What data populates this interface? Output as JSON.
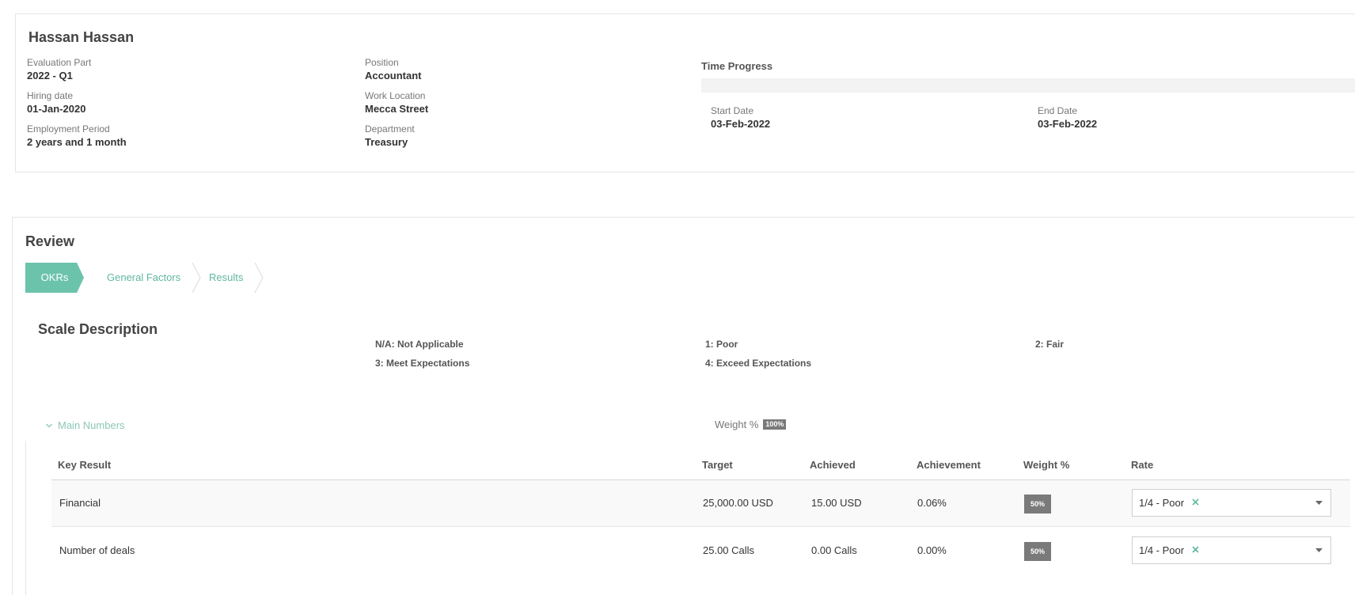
{
  "employee": {
    "name": "Hassan Hassan",
    "fields": {
      "evaluation_part": {
        "label": "Evaluation Part",
        "value": "2022 - Q1"
      },
      "hiring_date": {
        "label": "Hiring date",
        "value": "01-Jan-2020"
      },
      "employment_period": {
        "label": "Employment Period",
        "value": "2 years and 1 month"
      },
      "position": {
        "label": "Position",
        "value": "Accountant"
      },
      "work_location": {
        "label": "Work Location",
        "value": "Mecca Street"
      },
      "department": {
        "label": "Department",
        "value": "Treasury"
      }
    },
    "time_progress": {
      "title": "Time Progress",
      "progress_fraction": 0,
      "start": {
        "label": "Start Date",
        "value": "03-Feb-2022"
      },
      "end": {
        "label": "End Date",
        "value": "03-Feb-2022"
      }
    }
  },
  "review": {
    "title": "Review",
    "steps": [
      {
        "label": "OKRs",
        "active": true
      },
      {
        "label": "General Factors",
        "active": false
      },
      {
        "label": "Results",
        "active": false
      }
    ],
    "scale": {
      "title": "Scale Description",
      "items": [
        "N/A: Not Applicable",
        "1: Poor",
        "2: Fair",
        "3: Meet Expectations",
        "4: Exceed Expectations"
      ]
    },
    "group": {
      "name": "Main Numbers",
      "weight_label": "Weight %",
      "weight_value": "100%"
    },
    "table": {
      "headers": [
        "Key Result",
        "Target",
        "Achieved",
        "Achievement",
        "Weight %",
        "Rate"
      ],
      "rows": [
        {
          "key_result": "Financial",
          "target": "25,000.00 USD",
          "achieved": "15.00 USD",
          "achievement": "0.06%",
          "weight": "50%",
          "rate": "1/4 - Poor"
        },
        {
          "key_result": "Number of deals",
          "target": "25.00 Calls",
          "achieved": "0.00 Calls",
          "achievement": "0.00%",
          "weight": "50%",
          "rate": "1/4 - Poor"
        }
      ]
    }
  },
  "colors": {
    "accent": "#6cc3ac",
    "accent_text": "#5fb7a0",
    "badge": "#7a7a7a",
    "clear_icon": "#5fb7a0"
  },
  "icons": {
    "collapse": "chevron-down-icon",
    "step_separator": "chevron-right-icon",
    "clear": "close-icon",
    "dropdown": "caret-down-icon"
  }
}
